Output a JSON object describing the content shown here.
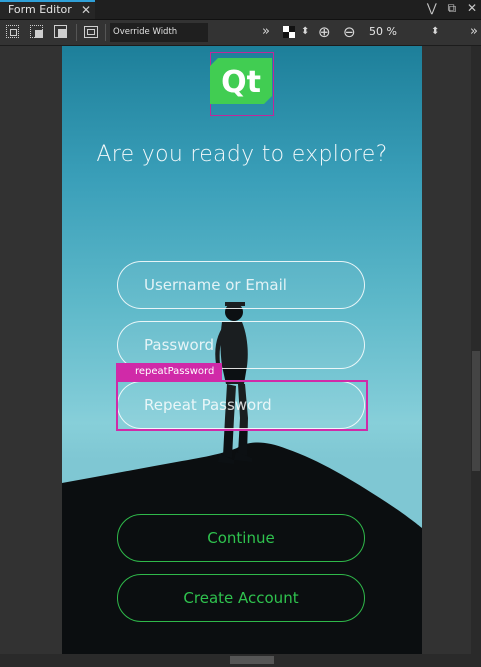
{
  "tab": {
    "title": "Form Editor",
    "close": "✕"
  },
  "tab_tools": {
    "collapse": "⋁",
    "float": "⧉",
    "close": "✕",
    "more": "»"
  },
  "toolbar": {
    "override_width": "Override Width",
    "more": "»",
    "zoom_level": "50 %",
    "more_right": "»"
  },
  "app": {
    "logo_text": "Qt",
    "headline": "Are you ready to explore?",
    "username_placeholder": "Username or Email",
    "password_placeholder": "Password",
    "repeat_password_placeholder": "Repeat Password",
    "selection_label": "repeatPassword",
    "continue_label": "Continue",
    "create_account_label": "Create Account"
  },
  "colors": {
    "selection": "#d02aa8",
    "qt_green": "#41cd52",
    "button_green": "#2fc24e",
    "tab_accent": "#2fa0d8"
  }
}
